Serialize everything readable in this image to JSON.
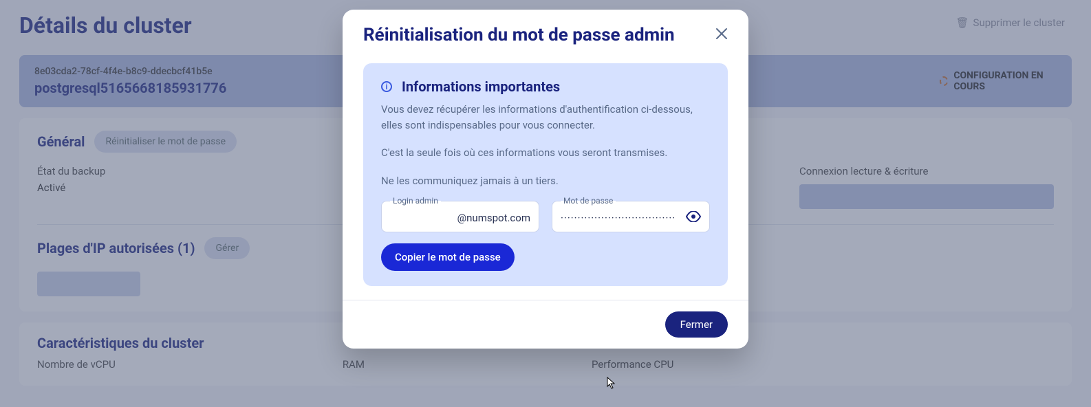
{
  "page": {
    "title": "Détails du cluster",
    "delete_label": "Supprimer le cluster"
  },
  "identity": {
    "uuid": "8e03cda2-78cf-4f4e-b8c9-ddecbcf41b5e",
    "name": "postgresql5165668185931776",
    "status": "CONFIGURATION EN COURS"
  },
  "general": {
    "title": "Général",
    "reset_pwd_btn": "Réinitialiser le mot de passe",
    "backup_label": "État du backup",
    "backup_value": "Activé",
    "connection_label": "Connexion lecture & écriture"
  },
  "ip": {
    "title": "Plages d'IP autorisées (1)",
    "manage_btn": "Gérer"
  },
  "characteristics": {
    "title": "Caractéristiques du cluster",
    "vcpu_label": "Nombre de vCPU",
    "ram_label": "RAM",
    "cpu_perf_label": "Performance CPU"
  },
  "modal": {
    "title": "Réinitialisation du mot de passe admin",
    "info_title": "Informations importantes",
    "info_p1": "Vous devez récupérer les informations d'authentification ci-dessous, elles sont indispensables pour vous connecter.",
    "info_p2": "C'est la seule fois où ces informations vous seront transmises.",
    "info_p3": "Ne les communiquez jamais à un tiers.",
    "login_label": "Login admin",
    "login_value": "@numspot.com",
    "password_label": "Mot de passe",
    "password_mask": "··································",
    "copy_btn": "Copier le mot de passe",
    "close_btn": "Fermer"
  }
}
